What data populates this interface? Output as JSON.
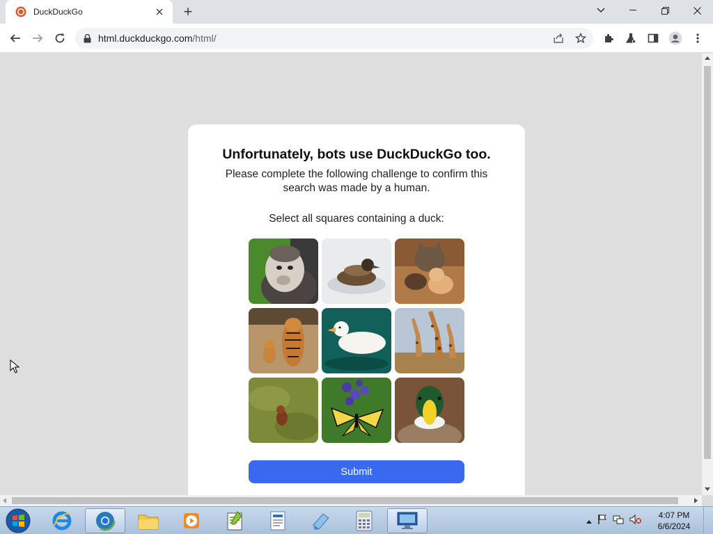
{
  "browser": {
    "tab_title": "DuckDuckGo",
    "new_tab_symbol": "+",
    "url_host": "html.duckduckgo.com",
    "url_path": "/html/",
    "icons": [
      "back-icon",
      "forward-icon",
      "reload-icon",
      "lock-icon",
      "share-icon",
      "star-icon",
      "extensions-icon",
      "lab-icon",
      "side-panel-icon",
      "profile-icon",
      "menu-icon"
    ]
  },
  "page": {
    "heading": "Unfortunately, bots use DuckDuckGo too.",
    "subtext": "Please complete the following challenge to confirm this search was made by a human.",
    "prompt": "Select all squares containing a duck:",
    "tiles": [
      {
        "subject": "monkey"
      },
      {
        "subject": "duck swimming"
      },
      {
        "subject": "cat with kittens"
      },
      {
        "subject": "tiger with cub"
      },
      {
        "subject": "white duck"
      },
      {
        "subject": "giraffes"
      },
      {
        "subject": "small animal in grass"
      },
      {
        "subject": "butterfly on flowers"
      },
      {
        "subject": "mallard duck"
      }
    ],
    "submit_label": "Submit",
    "accent": "#3969ef"
  },
  "taskbar": {
    "time": "4:07 PM",
    "date": "6/6/2024",
    "apps": [
      "start-orb",
      "internet-explorer-icon",
      "chrome-icon",
      "file-explorer-icon",
      "media-player-icon",
      "notepad-plus-icon",
      "wordpad-icon",
      "paint-icon",
      "calculator-icon",
      "remote-desktop-icon"
    ]
  }
}
